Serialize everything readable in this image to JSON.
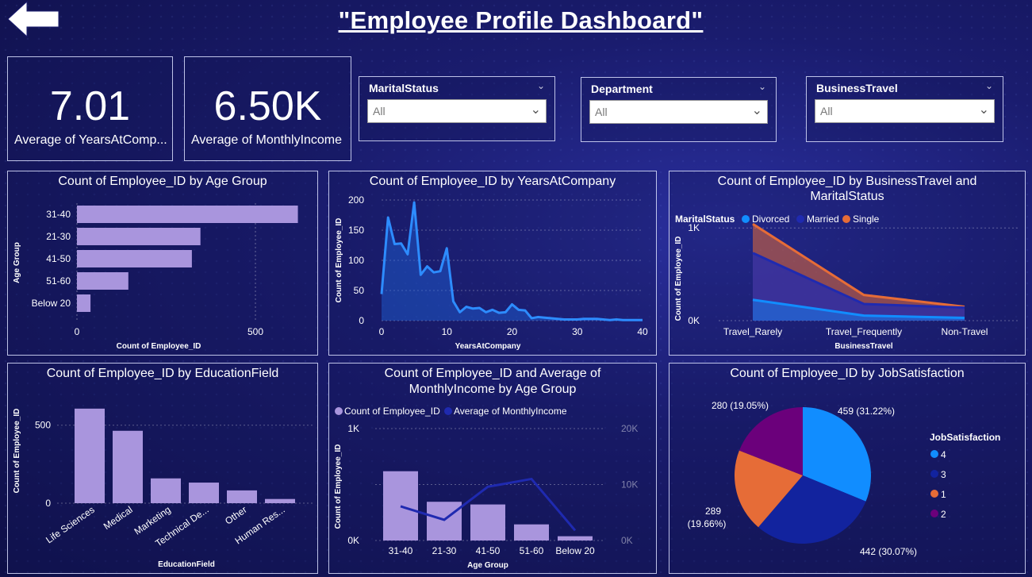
{
  "title": "\"Employee Profile Dashboard\"",
  "kpis": [
    {
      "value": "7.01",
      "label": "Average of YearsAtComp..."
    },
    {
      "value": "6.50K",
      "label": "Average of MonthlyIncome"
    }
  ],
  "slicers": [
    {
      "label": "MaritalStatus",
      "value": "All"
    },
    {
      "label": "Department",
      "value": "All"
    },
    {
      "label": "BusinessTravel",
      "value": "All"
    }
  ],
  "colors": {
    "bar": "#a995dd",
    "line": "#2d8cff",
    "divorced": "#118dff",
    "married": "#1f2ab0",
    "single": "#e66c37",
    "js4": "#118dff",
    "js3": "#12239e",
    "js1": "#e66c37",
    "js2": "#6b007b"
  },
  "charts": {
    "age": {
      "title": "Count of Employee_ID by Age Group",
      "ylabel": "Age Group",
      "xlabel": "Count of Employee_ID"
    },
    "years": {
      "title": "Count of Employee_ID by YearsAtCompany",
      "ylabel": "Count of Employee_ID",
      "xlabel": "YearsAtCompany"
    },
    "travel": {
      "title1": "Count of Employee_ID by BusinessTravel and",
      "title2": "MaritalStatus",
      "ylabel": "Count of Employee_ID",
      "xlabel": "BusinessTravel",
      "legend_title": "MaritalStatus"
    },
    "edu": {
      "title": "Count of Employee_ID by EducationField",
      "ylabel": "Count of Employee_ID",
      "xlabel": "EducationField"
    },
    "combo": {
      "title1": "Count of Employee_ID and Average of",
      "title2": "MonthlyIncome by Age Group",
      "ylabel": "Count of Employee_ID",
      "xlabel": "Age Group",
      "legend1": "Count of Employee_ID",
      "legend2": "Average of MonthlyIncome"
    },
    "pie": {
      "title": "Count of Employee_ID by JobSatisfaction",
      "legend_title": "JobSatisfaction"
    }
  },
  "chart_data": [
    {
      "type": "bar",
      "orientation": "horizontal",
      "categories": [
        "31-40",
        "21-30",
        "41-50",
        "51-60",
        "Below 20"
      ],
      "values": [
        619,
        346,
        322,
        144,
        38
      ],
      "xticks": [
        "0",
        "500"
      ],
      "xlim": [
        0,
        640
      ]
    },
    {
      "type": "area",
      "x": [
        0,
        1,
        2,
        3,
        4,
        5,
        6,
        7,
        8,
        9,
        10,
        11,
        12,
        13,
        14,
        15,
        16,
        17,
        18,
        19,
        20,
        21,
        22,
        23,
        24,
        25,
        26,
        27,
        28,
        29,
        30,
        31,
        32,
        33,
        34,
        35,
        36,
        37,
        38,
        39,
        40
      ],
      "values": [
        44,
        171,
        127,
        128,
        110,
        196,
        76,
        90,
        80,
        82,
        120,
        32,
        14,
        23,
        20,
        21,
        14,
        18,
        13,
        14,
        27,
        18,
        17,
        4,
        6,
        5,
        4,
        3,
        2,
        2,
        2,
        3,
        3,
        3,
        2,
        1,
        2,
        1,
        1,
        1,
        1
      ],
      "yticks": [
        "0",
        "50",
        "100",
        "150",
        "200"
      ],
      "xticks": [
        "0",
        "10",
        "20",
        "30",
        "40"
      ],
      "ylim": [
        0,
        200
      ]
    },
    {
      "type": "area",
      "categories": [
        "Travel_Rarely",
        "Travel_Frequently",
        "Non-Travel"
      ],
      "series": [
        {
          "name": "Divorced",
          "values": [
            225,
            55,
            30
          ]
        },
        {
          "name": "Married",
          "values": [
            730,
            180,
            140
          ]
        },
        {
          "name": "Single",
          "values": [
            1043,
            277,
            150
          ]
        }
      ],
      "yticks": [
        "0K",
        "1K"
      ],
      "ylim": [
        0,
        1250
      ]
    },
    {
      "type": "bar",
      "categories": [
        "Life Sciences",
        "Medical",
        "Marketing",
        "Technical De...",
        "Other",
        "Human Res..."
      ],
      "values": [
        606,
        464,
        159,
        132,
        82,
        27
      ],
      "yticks": [
        "0",
        "500"
      ],
      "ylim": [
        0,
        640
      ]
    },
    {
      "type": "bar",
      "categories": [
        "31-40",
        "21-30",
        "41-50",
        "51-60",
        "Below 20"
      ],
      "series": [
        {
          "name": "Count of Employee_ID",
          "values": [
            619,
            346,
            322,
            144,
            38
          ]
        },
        {
          "name": "Average of MonthlyIncome",
          "values": [
            6100,
            3700,
            9600,
            11000,
            1800
          ]
        }
      ],
      "yticks": [
        "0K",
        "1K"
      ],
      "y2ticks": [
        "0K",
        "10K",
        "20K"
      ],
      "ylim": [
        0,
        1000
      ],
      "y2lim": [
        0,
        20000
      ]
    },
    {
      "type": "pie",
      "categories": [
        "4",
        "3",
        "1",
        "2"
      ],
      "values": [
        459,
        442,
        289,
        280
      ],
      "labels": [
        "459 (31.22%)",
        "442 (30.07%)",
        "289 (19.66%)",
        "280 (19.05%)"
      ]
    }
  ]
}
